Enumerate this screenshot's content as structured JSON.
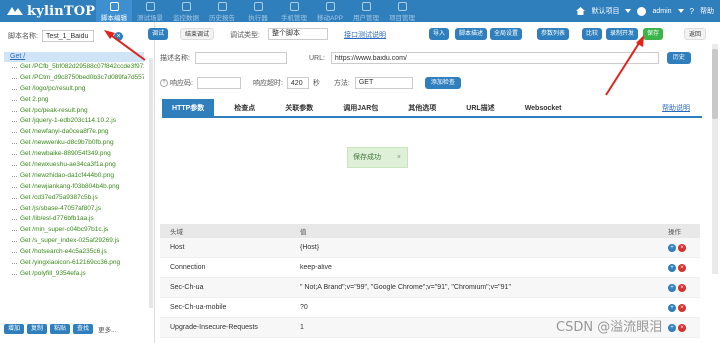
{
  "app": {
    "logo_text": "kylinTOP"
  },
  "nav": [
    {
      "label": "脚本编辑",
      "active": true
    },
    {
      "label": "测试场景"
    },
    {
      "label": "监控数据"
    },
    {
      "label": "历史报告"
    },
    {
      "label": "执行器"
    },
    {
      "label": "手机管理"
    },
    {
      "label": "移动APP"
    },
    {
      "label": "用户管理"
    },
    {
      "label": "项目管理"
    }
  ],
  "user": {
    "project": "默认项目",
    "username": "admin",
    "help": "帮助"
  },
  "left": {
    "script_name_label": "脚本名称:",
    "script_name_value": "Test_1_Baidu",
    "tree_root": "Get /",
    "tree_items": [
      "Get /PCfb_5bf082d29588c07f842ccde3f97243ea.png",
      "Get /PCtm_d9c8750bed0b3c7d089fa7d55720d6cf.png",
      "Get /logo/pc/result.png",
      "Get 2.png",
      "Get /pc/peak-result.png",
      "Get /jquery-1-edb203c114.10.2.js",
      "Get /newfanyi-da0cea8f7e.png",
      "Get /newwenku-d8c9b7b0fb.png",
      "Get /newbaike-889054f349.png",
      "Get /newxueshu-ae34ca3f1a.png",
      "Get /newzhidao-da1cf444b0.png",
      "Get /newjiankang-f03b804b4b.png",
      "Get /cd37ed75a9387c5b.js",
      "Get /js/sbase-47057af807.js",
      "Get /lib/esl-d776bfb1aa.js",
      "Get /min_super-c04bc97b1c.js",
      "Get /s_super_index-025af29269.js",
      "Get /hotsearch-e4c5a235c6.js",
      "Get /yingxiaoicon-612169cc36.png",
      "Get /polyfill_9354efa.js"
    ],
    "bottom_buttons": [
      "增加",
      "复制",
      "粘贴",
      "查找"
    ],
    "more": "更多..."
  },
  "toolbar": {
    "debug": "调试",
    "stop_debug": "结束调试",
    "debug_type_label": "调试类型:",
    "debug_type_value": "整个脚本",
    "port_help": "接口测试说明",
    "import": "导入",
    "script_desc": "脚本描述",
    "global_settings": "全局设置",
    "param_list": "参数列表",
    "compare": "比较",
    "record_dev": "录制开发",
    "save": "保存",
    "back": "返回"
  },
  "form": {
    "desc_label": "描述名称:",
    "url_label": "URL:",
    "url_value": "https://www.baidu.com/",
    "history": "历史",
    "resp_code_label": "响应码:",
    "timeout_label": "响应超时:",
    "timeout_value": "420",
    "timeout_unit": "秒",
    "method_label": "方法:",
    "method_value": "GET",
    "add_check": "添加检查"
  },
  "tabs": [
    "HTTP参数",
    "检查点",
    "关联参数",
    "调用JAR包",
    "其他选项",
    "URL描述",
    "Websocket"
  ],
  "tabs_help": "帮助说明",
  "toast": {
    "text": "保存成功",
    "close": "×"
  },
  "table": {
    "headers": [
      "头域",
      "值",
      "操作"
    ],
    "rows": [
      {
        "name": "Host",
        "value": "{Host}"
      },
      {
        "name": "Connection",
        "value": "keep-alive"
      },
      {
        "name": "Sec-Ch-ua",
        "value": "\" Not;A Brand\";v=\"99\", \"Google Chrome\";v=\"91\", \"Chromium\";v=\"91\""
      },
      {
        "name": "Sec-Ch-ua-mobile",
        "value": "?0"
      },
      {
        "name": "Upgrade-Insecure-Requests",
        "value": "1"
      }
    ]
  },
  "watermark": "CSDN @溢流眼泪",
  "colors": {
    "primary": "#2f7fbd",
    "save_green": "#3bb54a",
    "tree_green": "#3a8b1c",
    "arrow_red": "#e2231a"
  }
}
